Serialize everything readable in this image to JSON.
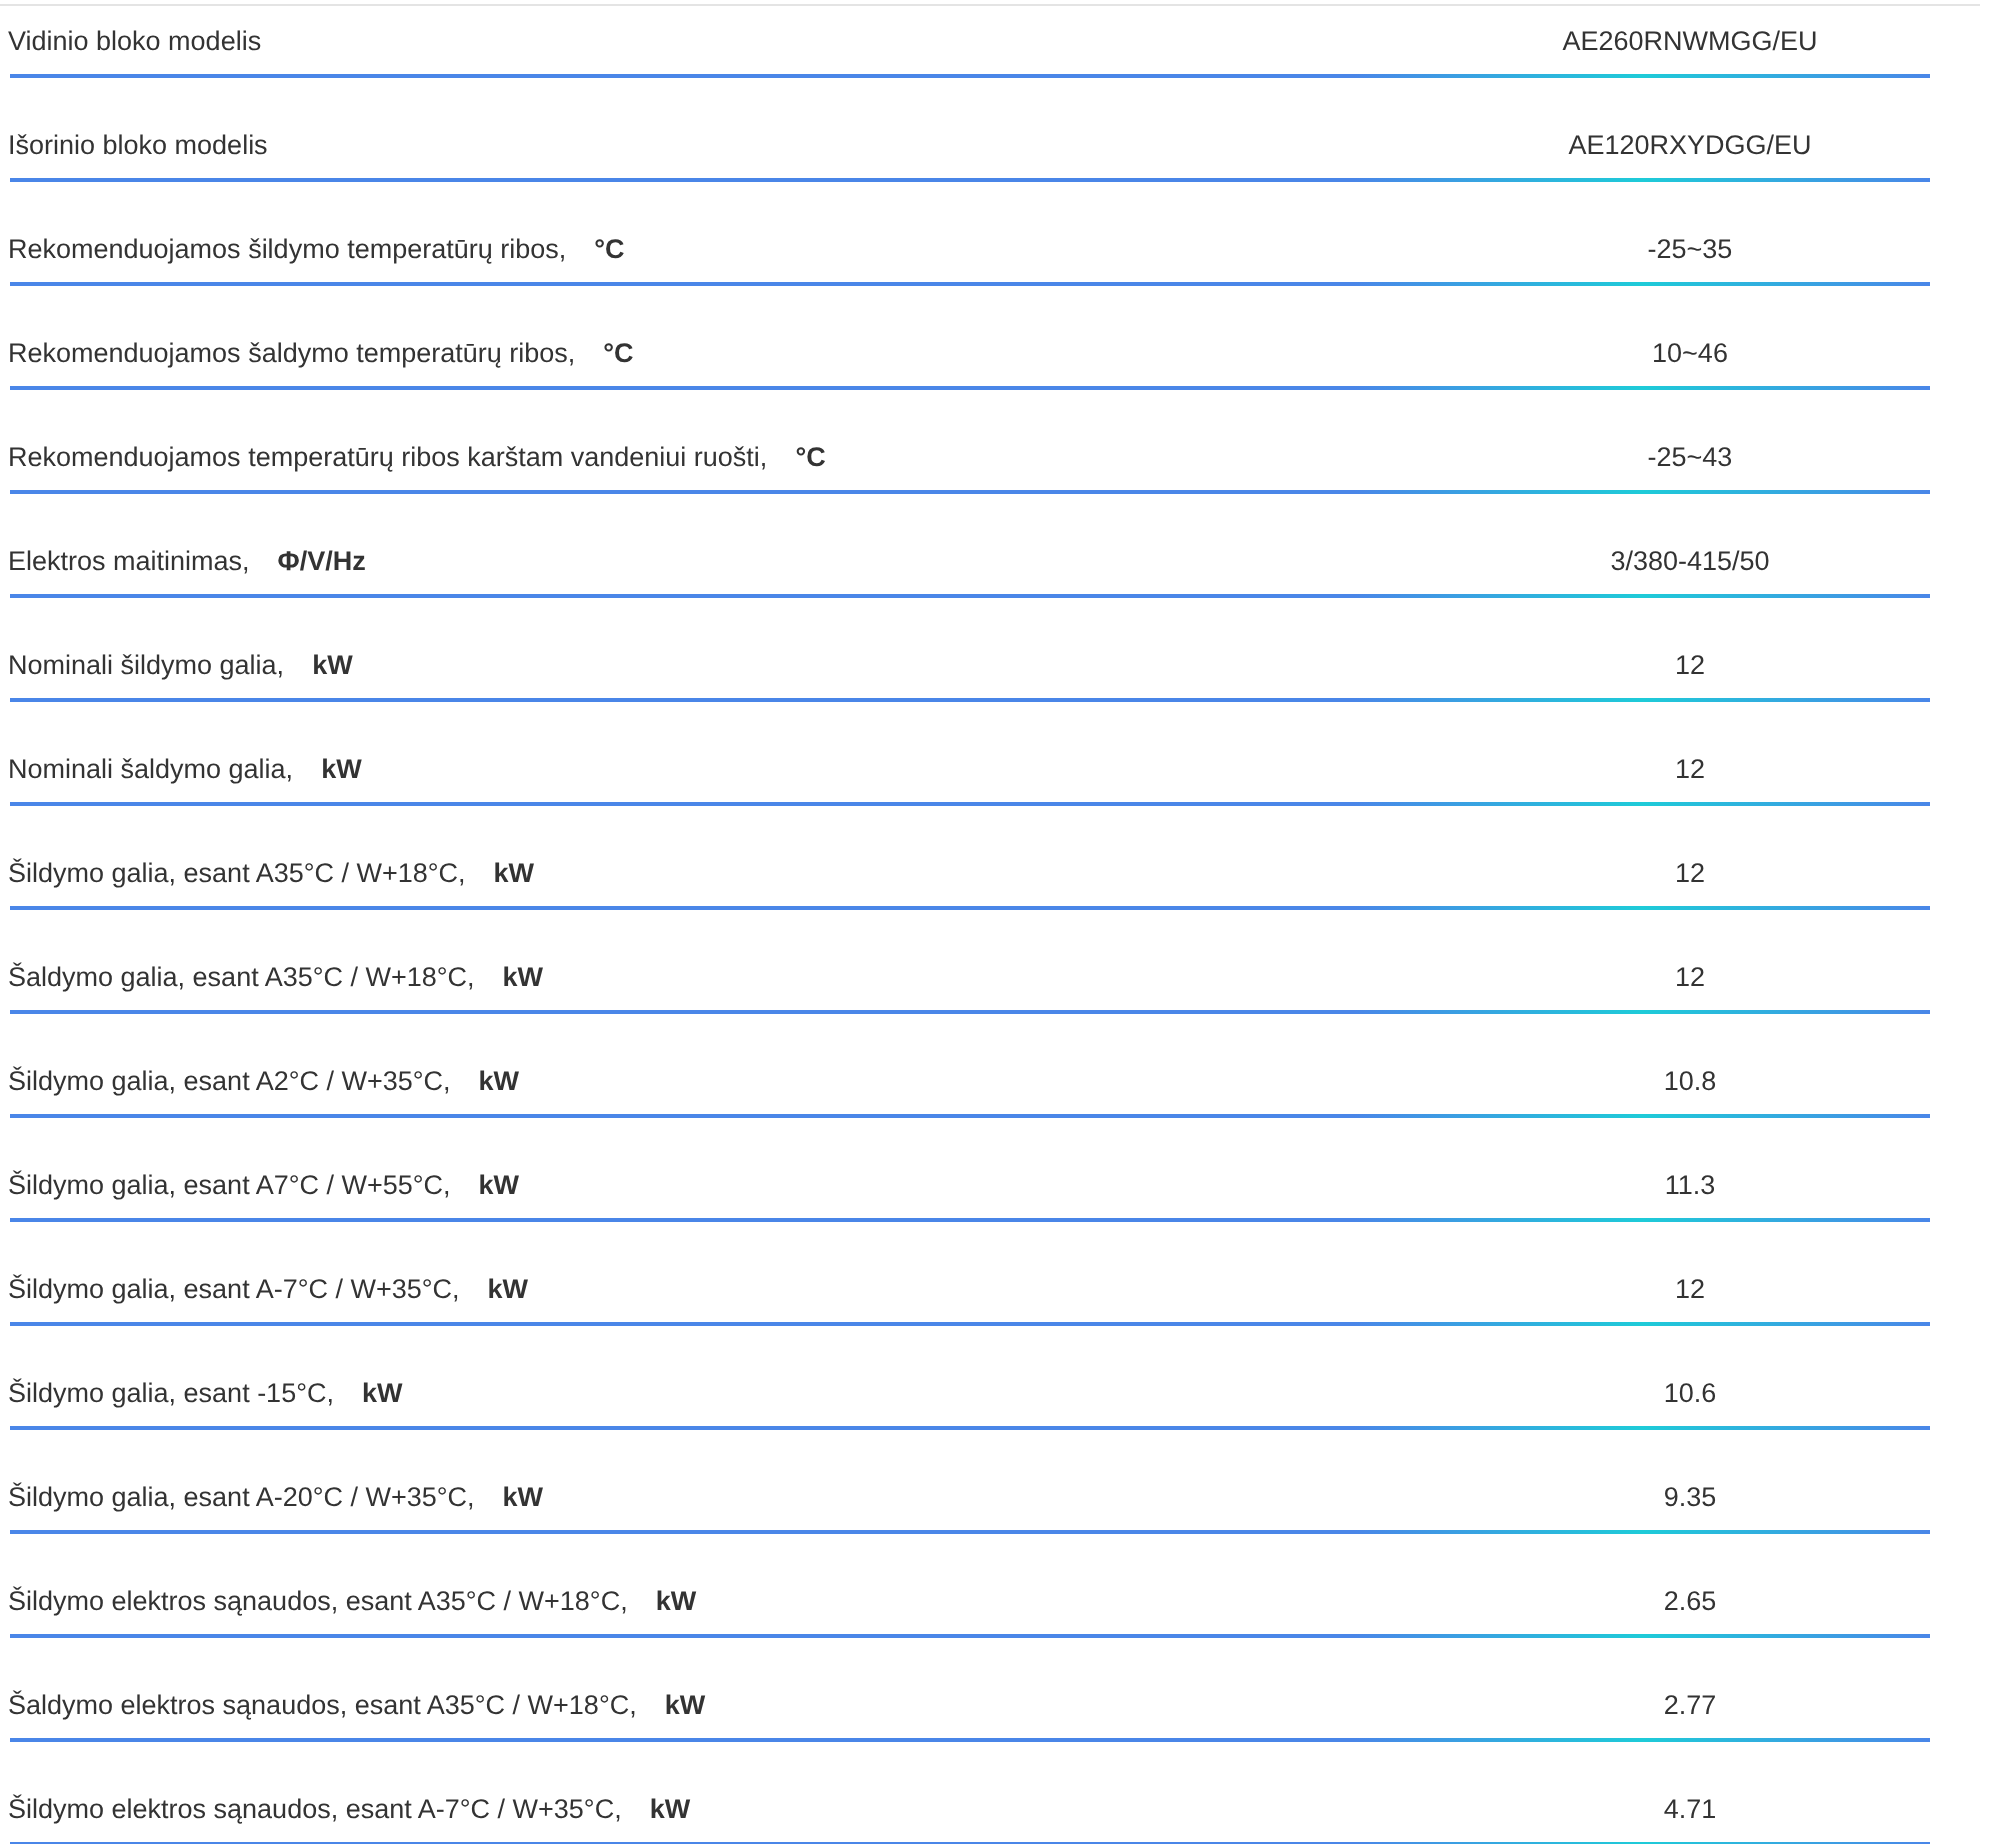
{
  "specs": [
    {
      "label": "Vidinio bloko modelis",
      "value": "AE260RNWMGG/EU"
    },
    {
      "label": "Išorinio bloko modelis",
      "value": "AE120RXYDGG/EU"
    },
    {
      "label": "Rekomenduojamos šildymo temperatūrų ribos,",
      "unit": "°C",
      "value": "-25~35"
    },
    {
      "label": "Rekomenduojamos šaldymo temperatūrų ribos,",
      "unit": "°C",
      "value": "10~46"
    },
    {
      "label": "Rekomenduojamos temperatūrų ribos karštam vandeniui ruošti,",
      "unit": "°C",
      "value": "-25~43"
    },
    {
      "label": "Elektros maitinimas,",
      "unit": "Φ/V/Hz",
      "value": "3/380-415/50"
    },
    {
      "label": "Nominali šildymo galia,",
      "unit": "kW",
      "value": "12"
    },
    {
      "label": "Nominali šaldymo galia,",
      "unit": "kW",
      "value": "12"
    },
    {
      "label": "Šildymo galia, esant A35°C / W+18°C,",
      "unit": "kW",
      "value": "12"
    },
    {
      "label": "Šaldymo galia, esant A35°C / W+18°C,",
      "unit": "kW",
      "value": "12"
    },
    {
      "label": "Šildymo galia, esant A2°C / W+35°C,",
      "unit": "kW",
      "value": "10.8"
    },
    {
      "label": "Šildymo galia, esant A7°C / W+55°C,",
      "unit": "kW",
      "value": "11.3"
    },
    {
      "label": "Šildymo galia, esant A-7°C / W+35°C,",
      "unit": "kW",
      "value": "12"
    },
    {
      "label": "Šildymo galia, esant -15°C,",
      "unit": "kW",
      "value": "10.6"
    },
    {
      "label": "Šildymo galia, esant A-20°C / W+35°C,",
      "unit": "kW",
      "value": "9.35"
    },
    {
      "label": "Šildymo elektros sąnaudos, esant A35°C / W+18°C,",
      "unit": "kW",
      "value": "2.65"
    },
    {
      "label": "Šaldymo elektros sąnaudos, esant A35°C / W+18°C,",
      "unit": "kW",
      "value": "2.77"
    },
    {
      "label": "Šildymo elektros sąnaudos, esant A-7°C / W+35°C,",
      "unit": "kW",
      "value": "4.71"
    }
  ]
}
